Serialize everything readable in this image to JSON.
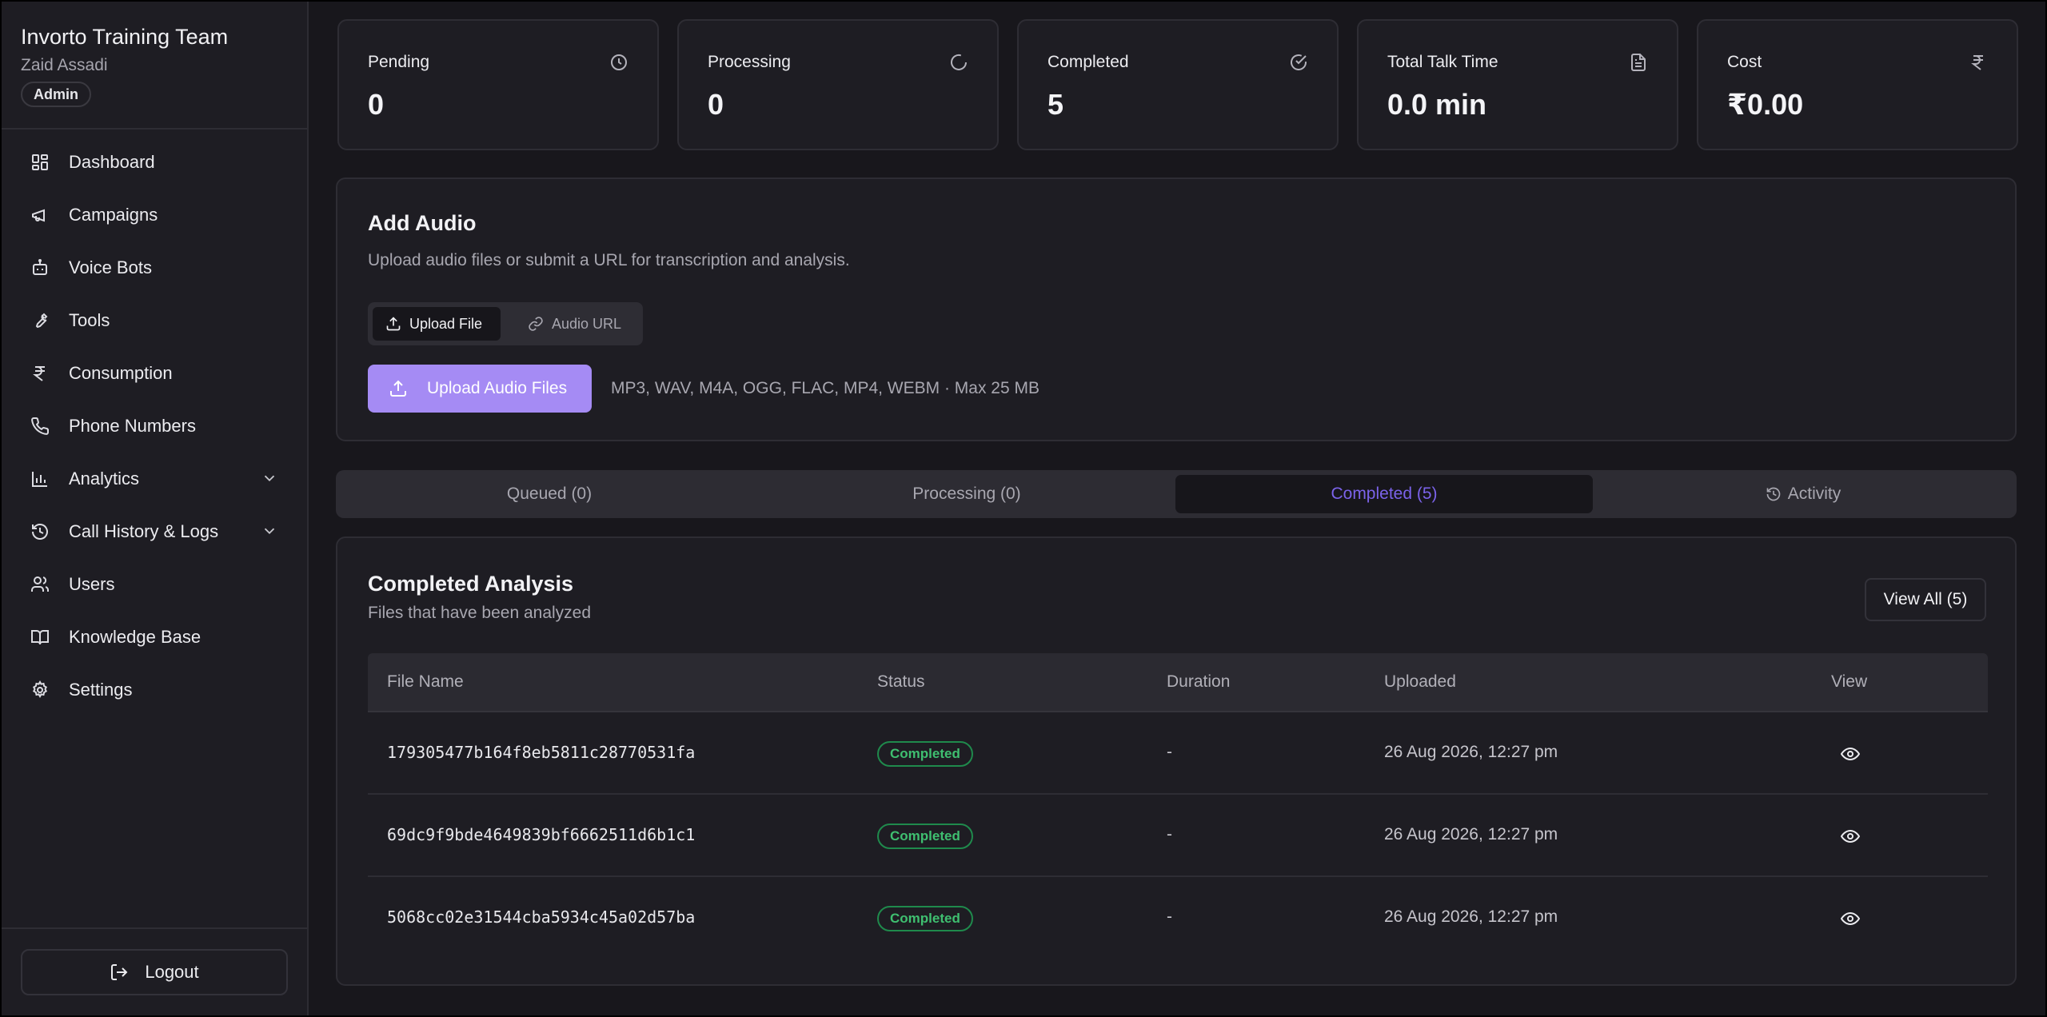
{
  "sidebar": {
    "team": "Invorto Training Team",
    "user": "Zaid Assadi",
    "role": "Admin",
    "items": [
      {
        "label": "Dashboard",
        "icon": "dashboard-icon"
      },
      {
        "label": "Campaigns",
        "icon": "megaphone-icon"
      },
      {
        "label": "Voice Bots",
        "icon": "bot-icon"
      },
      {
        "label": "Tools",
        "icon": "wrench-icon"
      },
      {
        "label": "Consumption",
        "icon": "rupee-icon"
      },
      {
        "label": "Phone Numbers",
        "icon": "phone-icon"
      },
      {
        "label": "Analytics",
        "icon": "bar-chart-icon",
        "expandable": true
      },
      {
        "label": "Call History & Logs",
        "icon": "history-icon",
        "expandable": true
      },
      {
        "label": "Users",
        "icon": "users-icon"
      },
      {
        "label": "Knowledge Base",
        "icon": "book-icon"
      },
      {
        "label": "Settings",
        "icon": "gear-icon"
      }
    ],
    "logout": "Logout"
  },
  "stats": [
    {
      "label": "Pending",
      "value": "0",
      "icon": "clock-icon"
    },
    {
      "label": "Processing",
      "value": "0",
      "icon": "spinner-icon"
    },
    {
      "label": "Completed",
      "value": "5",
      "icon": "check-circle-icon"
    },
    {
      "label": "Total Talk Time",
      "value": "0.0 min",
      "icon": "document-icon"
    },
    {
      "label": "Cost",
      "value": "₹0.00",
      "icon": "rupee-icon"
    }
  ],
  "add_audio": {
    "title": "Add Audio",
    "description": "Upload audio files or submit a URL for transcription and analysis.",
    "mode_upload": "Upload File",
    "mode_url": "Audio URL",
    "upload_button": "Upload Audio Files",
    "hint": "MP3, WAV, M4A, OGG, FLAC, MP4, WEBM · Max 25 MB"
  },
  "tabs": [
    {
      "label": "Queued (0)"
    },
    {
      "label": "Processing (0)"
    },
    {
      "label": "Completed (5)",
      "active": true
    },
    {
      "label": "Activity"
    }
  ],
  "completed": {
    "title": "Completed Analysis",
    "subtitle": "Files that have been analyzed",
    "view_all": "View All (5)",
    "columns": [
      "File Name",
      "Status",
      "Duration",
      "Uploaded",
      "View"
    ],
    "rows": [
      {
        "file": "179305477b164f8eb5811c28770531fa",
        "status": "Completed",
        "duration": "-",
        "uploaded": "26 Aug 2026, 12:27 pm"
      },
      {
        "file": "69dc9f9bde4649839bf6662511d6b1c1",
        "status": "Completed",
        "duration": "-",
        "uploaded": "26 Aug 2026, 12:27 pm"
      },
      {
        "file": "5068cc02e31544cba5934c45a02d57ba",
        "status": "Completed",
        "duration": "-",
        "uploaded": "26 Aug 2026, 12:27 pm"
      }
    ]
  },
  "colors": {
    "accent": "#a58bf4",
    "active_tab_text": "#7b63ea",
    "success": "#3fbf70",
    "background": "#18171c",
    "card": "#1e1d23"
  }
}
